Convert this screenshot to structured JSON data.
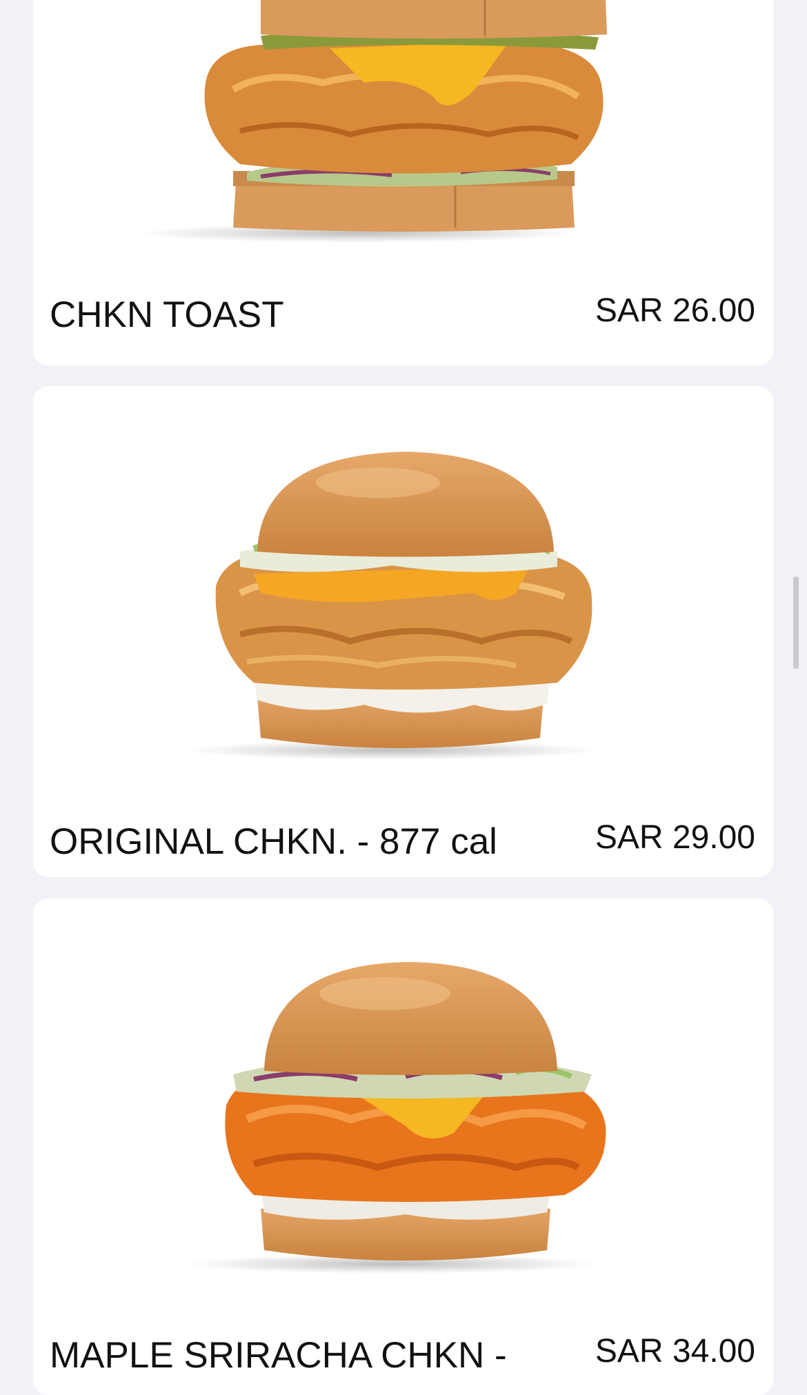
{
  "menu_items": [
    {
      "name": "CHKN TOAST",
      "price": "SAR 26.00",
      "image": "chkn-toast-image"
    },
    {
      "name": "ORIGINAL CHKN. - 877 cal",
      "price": "SAR 29.00",
      "image": "original-chkn-image"
    },
    {
      "name": "MAPLE SRIRACHA CHKN -",
      "price": "SAR 34.00",
      "image": "maple-sriracha-chkn-image"
    }
  ],
  "colors": {
    "page_background": "#f1f2f7",
    "card_background": "#ffffff",
    "text": "#111111"
  }
}
